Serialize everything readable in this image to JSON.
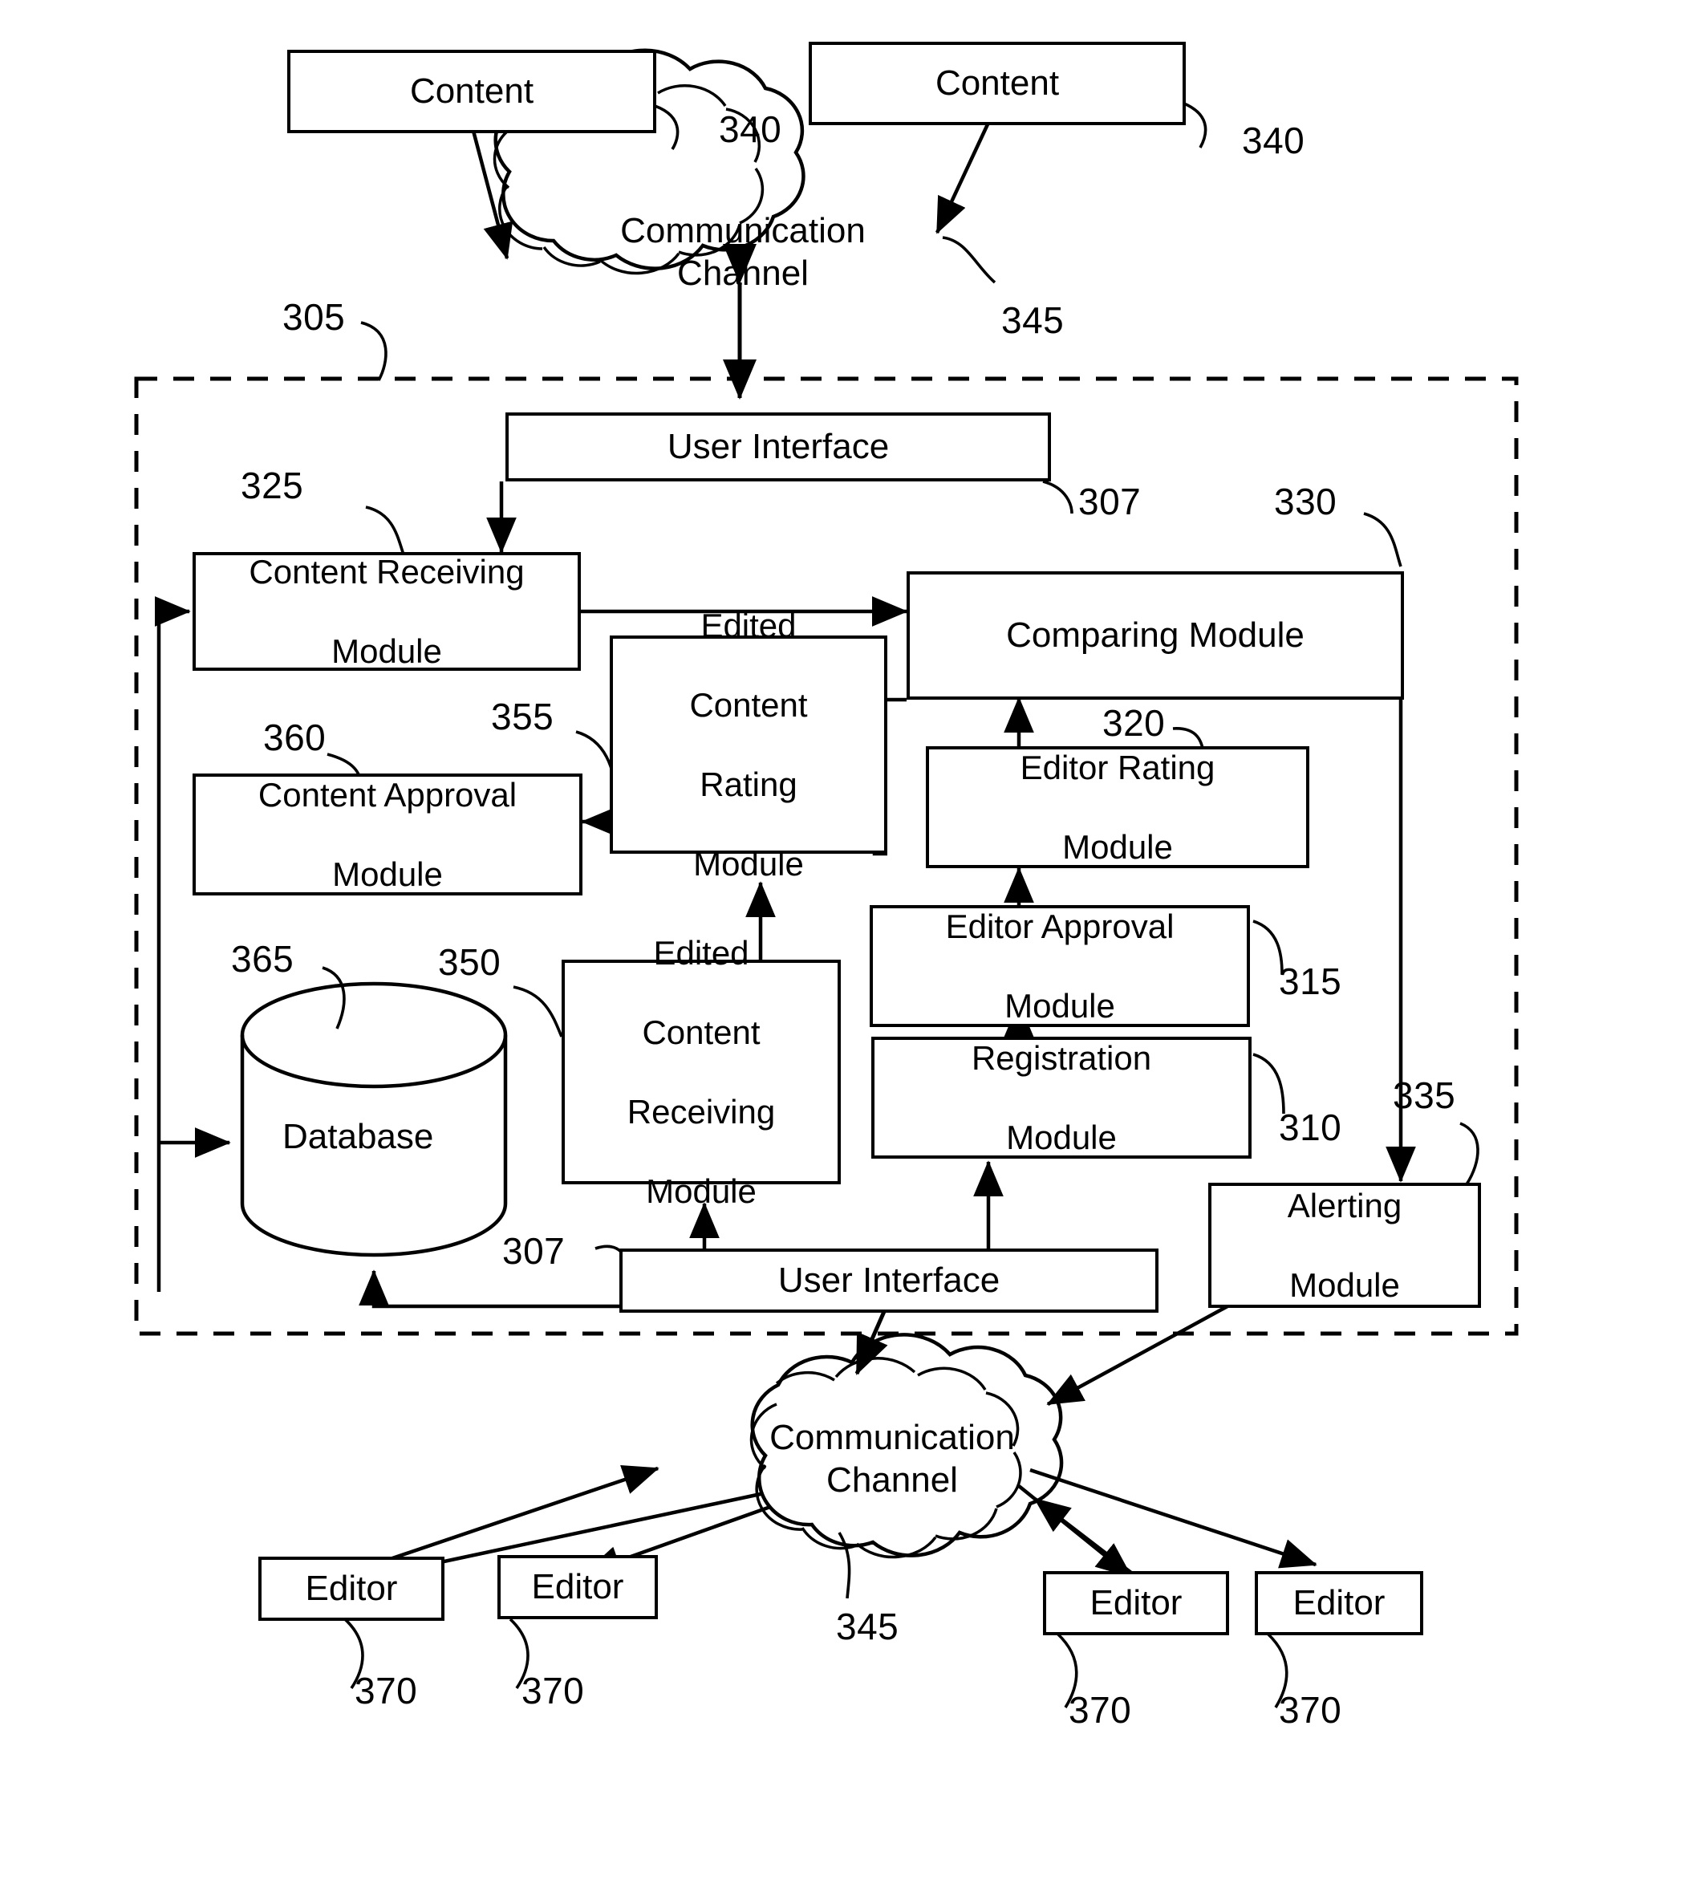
{
  "figure": {
    "title": "Content editing system block diagram",
    "stroke_color": "#000000",
    "background_color": "#ffffff"
  },
  "top": {
    "content_left": "Content",
    "content_right": "Content",
    "content_left_ref": "340",
    "content_right_ref": "340",
    "cloud_line1": "Communication",
    "cloud_line2": "Channel",
    "cloud_ref": "345"
  },
  "system": {
    "ref": "305",
    "user_interface_top": "User Interface",
    "user_interface_top_ref": "307",
    "user_interface_bottom": "User Interface",
    "user_interface_bottom_ref": "307",
    "modules": [
      {
        "label_line1": "Content Receiving",
        "label_line2": "Module",
        "ref": "325"
      },
      {
        "label_line1": "Comparing Module",
        "label_line2": "",
        "ref": "330"
      },
      {
        "label_line1": "Edited",
        "label_line2": "Content",
        "label_line3": "Rating",
        "label_line4": "Module",
        "ref": "355"
      },
      {
        "label_line1": "Editor Rating",
        "label_line2": "Module",
        "ref": "320"
      },
      {
        "label_line1": "Content Approval",
        "label_line2": "Module",
        "ref": "360"
      },
      {
        "label_line1": "Editor Approval",
        "label_line2": "Module",
        "ref": "315"
      },
      {
        "label_line1": "Edited",
        "label_line2": "Content",
        "label_line3": "Receiving",
        "label_line4": "Module",
        "ref": "350"
      },
      {
        "label_line1": "Registration",
        "label_line2": "Module",
        "ref": "310"
      },
      {
        "label_line1": "Alerting",
        "label_line2": "Module",
        "ref": "335"
      }
    ],
    "database": {
      "label": "Database",
      "ref": "365"
    }
  },
  "bottom": {
    "cloud_line1": "Communication",
    "cloud_line2": "Channel",
    "cloud_ref": "345",
    "editors": [
      {
        "label": "Editor",
        "ref": "370"
      },
      {
        "label": "Editor",
        "ref": "370"
      },
      {
        "label": "Editor",
        "ref": "370"
      },
      {
        "label": "Editor",
        "ref": "370"
      }
    ]
  }
}
